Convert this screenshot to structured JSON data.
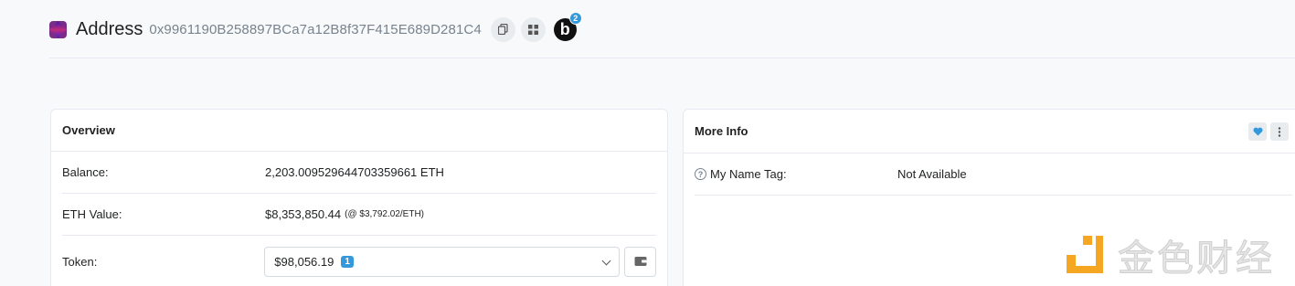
{
  "header": {
    "title": "Address",
    "address": "0x9961190B258897BCa7a12B8f37F415E689D281C4",
    "blockie_letter": "b",
    "blockie_badge": "2"
  },
  "overview": {
    "title": "Overview",
    "balance_label": "Balance:",
    "balance_value": "2,203.009529644703359661 ETH",
    "eth_value_label": "ETH Value:",
    "eth_value": "$8,353,850.44",
    "eth_price": "(@ $3,792.02/ETH)",
    "token_label": "Token:",
    "token_value": "$98,056.19",
    "token_count": "1"
  },
  "more_info": {
    "title": "More Info",
    "name_tag_label": "My Name Tag:",
    "name_tag_value": "Not Available"
  },
  "watermark": {
    "text": "金色财经"
  },
  "colors": {
    "accent": "#3498db",
    "border": "#e7eaf3",
    "muted": "#77838f",
    "watermark_orange": "#f5a623"
  }
}
